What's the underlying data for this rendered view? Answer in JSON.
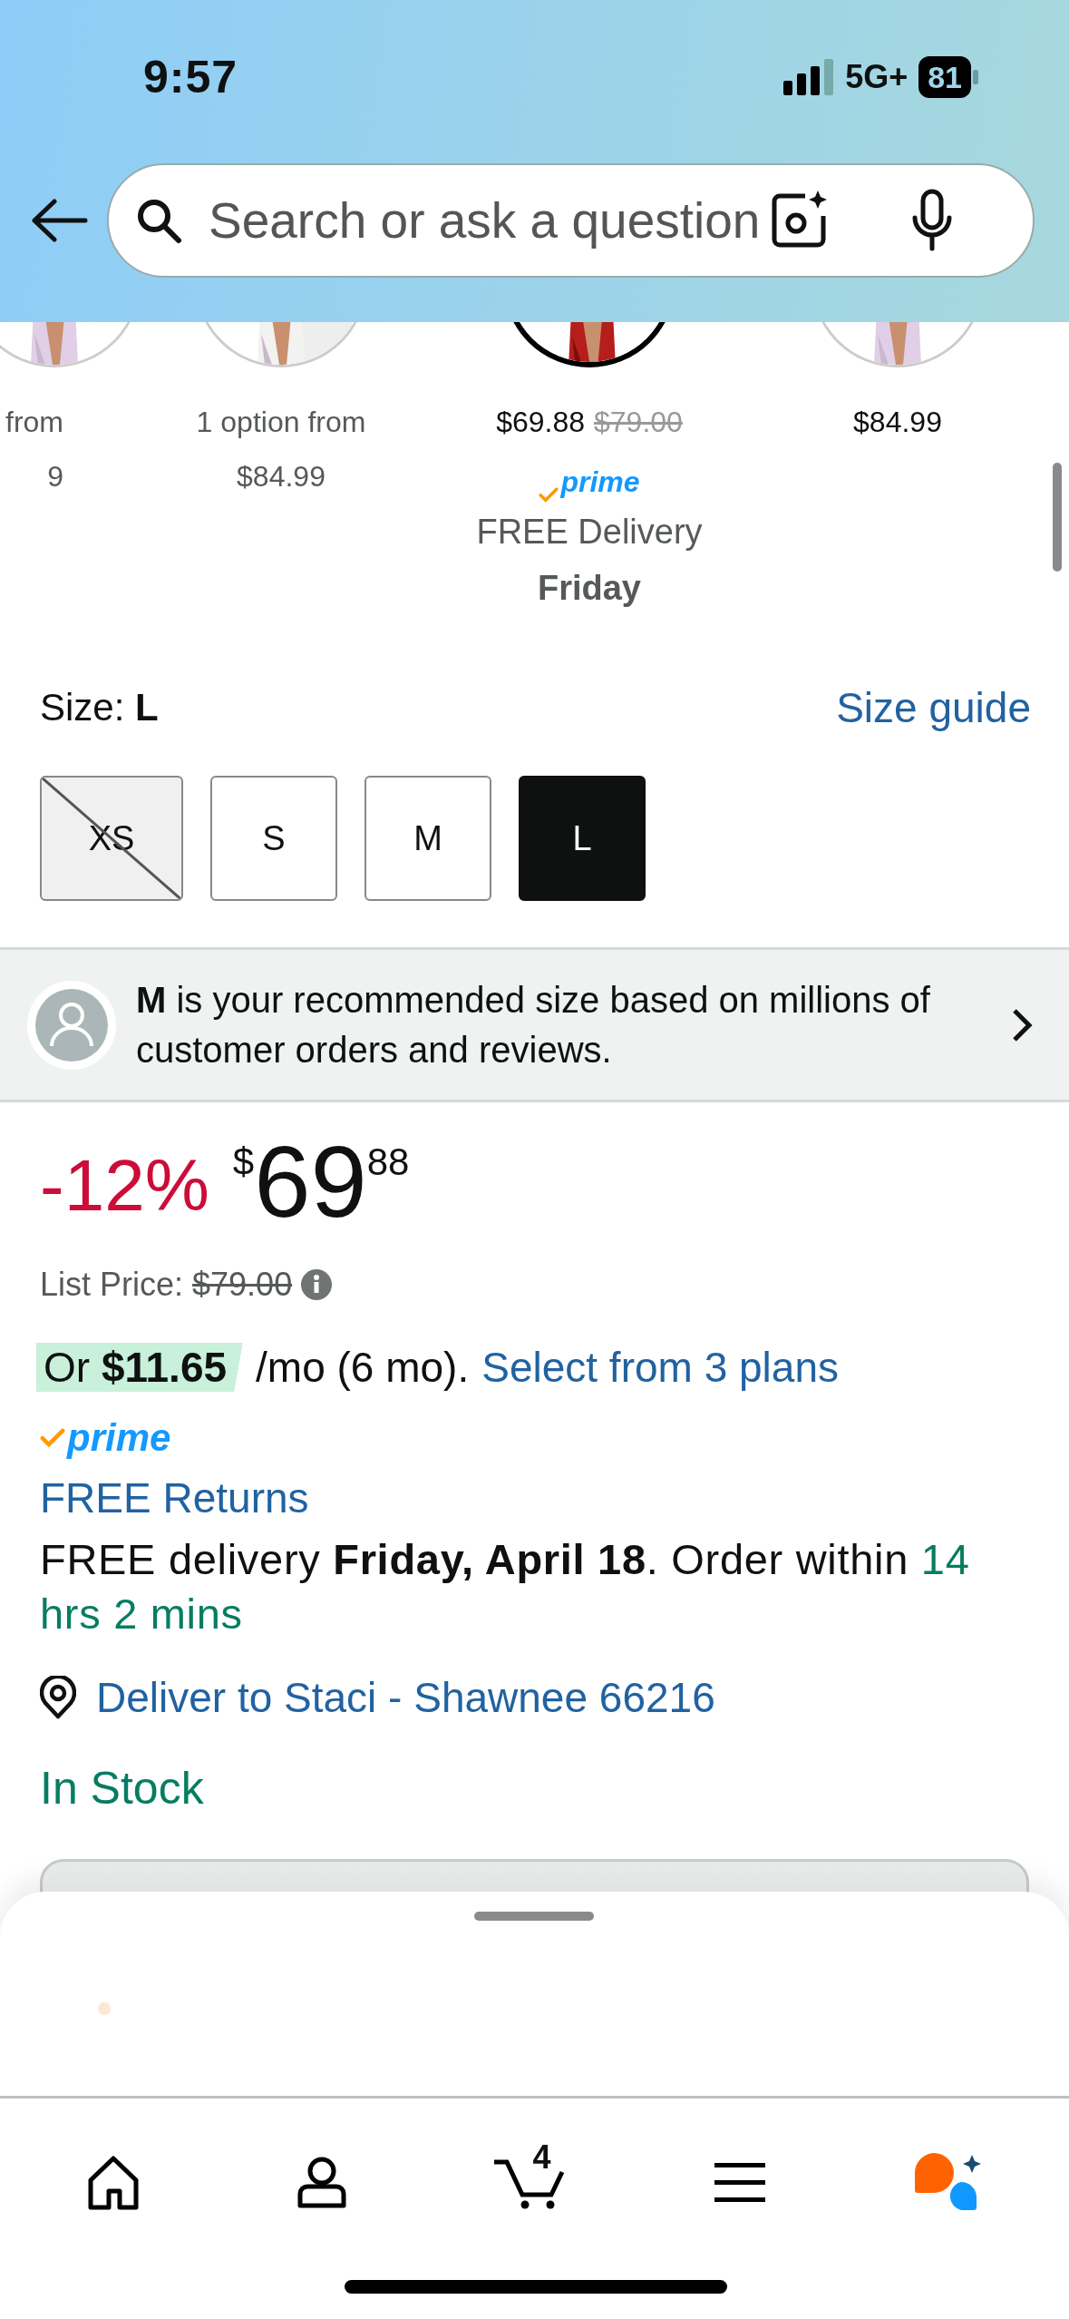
{
  "status_bar": {
    "time": "9:57",
    "network": "5G+",
    "battery": "81"
  },
  "search": {
    "placeholder": "Search or ask a question"
  },
  "variants": [
    {
      "kind": "options",
      "selected": false,
      "label": "from",
      "price": "9"
    },
    {
      "kind": "options",
      "selected": false,
      "label": "1 option from",
      "price": "$84.99"
    },
    {
      "kind": "offer",
      "selected": true,
      "price": "$69.88",
      "list_price": "$79.00",
      "prime": "prime",
      "delivery": "FREE Delivery",
      "delivery_day": "Friday"
    },
    {
      "kind": "offer",
      "selected": false,
      "price": "$84.99"
    }
  ],
  "size": {
    "label": "Size:",
    "value": "L",
    "guide_link": "Size guide",
    "options": [
      {
        "label": "XS",
        "selected": false,
        "available": false
      },
      {
        "label": "S",
        "selected": false,
        "available": true
      },
      {
        "label": "M",
        "selected": false,
        "available": true
      },
      {
        "label": "L",
        "selected": true,
        "available": true
      }
    ]
  },
  "recommendation": {
    "text": "**M** is your recommended size based on millions of customer orders and reviews."
  },
  "price": {
    "discount": "-12%",
    "currency": "$",
    "whole": "69",
    "fraction": "88",
    "list_price_label": "List Price:",
    "list_price": "$79.00"
  },
  "installment": {
    "badge": "Or **$11.65**",
    "terms": "/mo (6 mo).",
    "link": "Select from 3 plans"
  },
  "prime": "prime",
  "returns_link": "FREE Returns",
  "delivery": {
    "text": "FREE delivery **Friday, April 18**. Order within",
    "countdown": "14 hrs 2 mins"
  },
  "deliver_to": "Deliver to Staci - Shawnee 66216",
  "stock": "In Stock",
  "tab_bar": {
    "cart_count": "4"
  }
}
